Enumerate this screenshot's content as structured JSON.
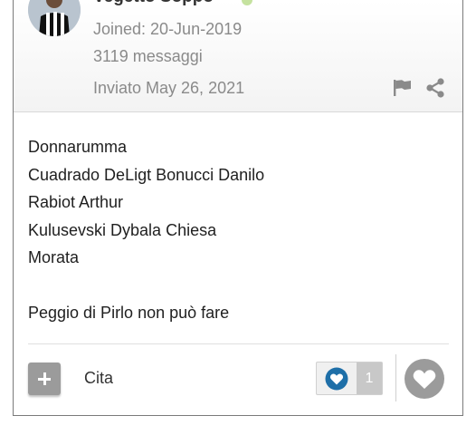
{
  "post": {
    "username": "Vegetto Soppo",
    "joined": "Joined: 20-Jun-2019",
    "message_count": "3119 messaggi",
    "posted_date": "Inviato May 26, 2021",
    "content_lines": [
      "Donnarumma",
      "Cuadrado DeLigt Bonucci Danilo",
      "Rabiot Arthur",
      "Kulusevski Dybala Chiesa",
      "Morata",
      "",
      "Peggio di Pirlo non può fare"
    ]
  },
  "actions": {
    "quote_label": "Cita",
    "reaction_count": "1"
  },
  "colors": {
    "meta_text": "#8a8a8a",
    "button_gray": "#9b9b9b",
    "reaction_blue": "#1e6fa8",
    "online_green": "#8cc63f"
  },
  "icons": {
    "flag": "flag-icon",
    "share": "share-icon",
    "plus": "plus-icon",
    "reaction": "heart-reaction-icon",
    "like": "heart-icon"
  }
}
